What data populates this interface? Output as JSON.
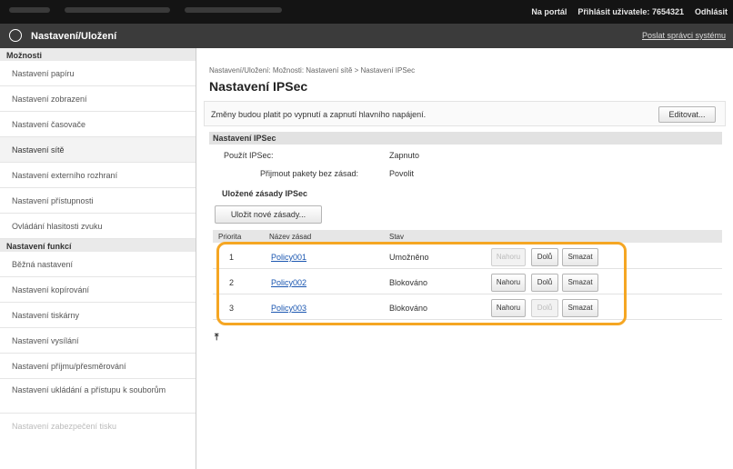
{
  "topbar": {
    "portal": "Na portál",
    "login_label": "Přihlásit uživatele:",
    "user_id": "7654321",
    "logout": "Odhlásit"
  },
  "appbar": {
    "title": "Nastavení/Uložení",
    "mail_admin": "Poslat správci systému"
  },
  "sidebar": {
    "section1": "Možnosti",
    "items1": [
      "Nastavení papíru",
      "Nastavení zobrazení",
      "Nastavení časovače",
      "Nastavení sítě",
      "Nastavení externího rozhraní",
      "Nastavení přístupnosti",
      "Ovládání hlasitosti zvuku"
    ],
    "section2": "Nastavení funkcí",
    "items2": [
      "Běžná nastavení",
      "Nastavení kopírování",
      "Nastavení tiskárny",
      "Nastavení vysílání",
      "Nastavení příjmu/přesměrování",
      "Nastavení ukládání a přístupu k souborům",
      "Nastavení zabezpečení tisku"
    ]
  },
  "main": {
    "breadcrumb": "Nastavení/Uložení: Možnosti: Nastavení sítě > Nastavení IPSec",
    "title": "Nastavení IPSec",
    "notice": "Změny budou platit po vypnutí a zapnutí hlavního napájení.",
    "edit_button": "Editovat...",
    "section_title": "Nastavení IPSec",
    "use_ipsec_label": "Použít IPSec:",
    "use_ipsec_value": "Zapnuto",
    "accept_label": "Přijmout pakety bez zásad:",
    "accept_value": "Povolit",
    "saved_policies": "Uložené zásady IPSec",
    "save_new_button": "Uložit nové zásady...",
    "table": {
      "headers": [
        "Priorita",
        "Název zásad",
        "Stav"
      ],
      "rows": [
        {
          "priority": "1",
          "name": "Policy001",
          "status": "Umožněno"
        },
        {
          "priority": "2",
          "name": "Policy002",
          "status": "Blokováno"
        },
        {
          "priority": "3",
          "name": "Policy003",
          "status": "Blokováno"
        }
      ],
      "up_label": "Nahoru",
      "down_label": "Dolů",
      "delete_label": "Smazat"
    },
    "top_icon": "go-to-top-icon"
  },
  "colors": {
    "highlight": "#f5a623",
    "link": "#1a56b0",
    "appbar": "#3b3b3b",
    "topbar": "#141414"
  }
}
